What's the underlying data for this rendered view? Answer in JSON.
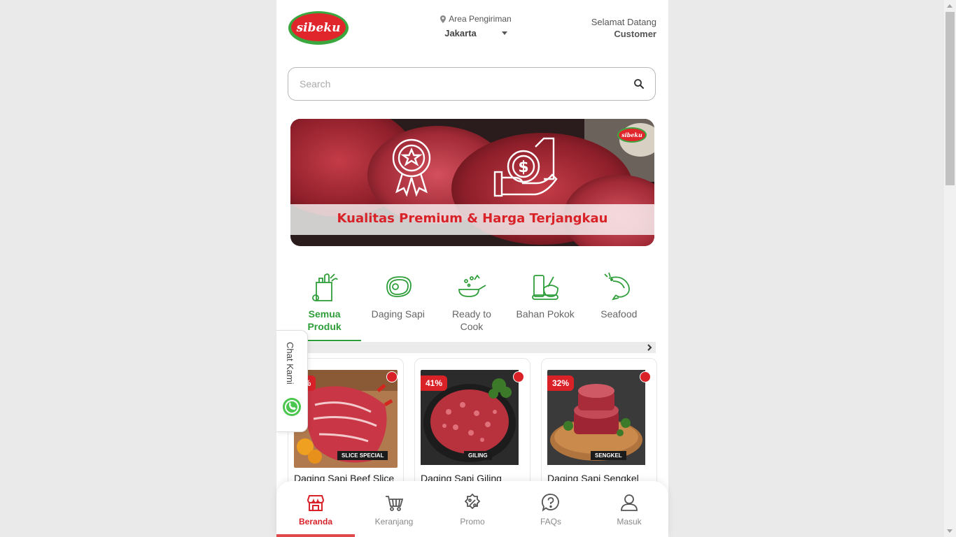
{
  "header": {
    "logo_text": "sibeku",
    "area_label": "Area Pengiriman",
    "area_value": "Jakarta",
    "welcome_label": "Selamat Datang",
    "welcome_user": "Customer"
  },
  "search": {
    "placeholder": "Search",
    "value": ""
  },
  "banner": {
    "text": "Kualitas Premium & Harga Terjangkau",
    "logo_text": "sibeku"
  },
  "categories": [
    {
      "label": "Semua Produk",
      "icon": "grocery-bag-icon",
      "active": true
    },
    {
      "label": "Daging Sapi",
      "icon": "steak-icon",
      "active": false
    },
    {
      "label": "Ready to Cook",
      "icon": "frying-pan-icon",
      "active": false
    },
    {
      "label": "Bahan Pokok",
      "icon": "ingredients-icon",
      "active": false
    },
    {
      "label": "Seafood",
      "icon": "shrimp-icon",
      "active": false
    }
  ],
  "products": [
    {
      "name": "Daging Sapi Beef Slice",
      "discount": "0%",
      "pack_label": "SLICE SPECIAL"
    },
    {
      "name": "Daging Sapi Giling",
      "discount": "41%",
      "pack_label": "GILING"
    },
    {
      "name": "Daging Sapi Sengkel",
      "discount": "32%",
      "pack_label": "SENGKEL"
    }
  ],
  "chat": {
    "label": "Chat Kami",
    "icon": "whatsapp-icon"
  },
  "bottom_nav": [
    {
      "label": "Beranda",
      "icon": "store-icon",
      "active": true
    },
    {
      "label": "Keranjang",
      "icon": "cart-icon",
      "active": false
    },
    {
      "label": "Promo",
      "icon": "discount-icon",
      "active": false
    },
    {
      "label": "FAQs",
      "icon": "question-icon",
      "active": false
    },
    {
      "label": "Masuk",
      "icon": "user-icon",
      "active": false
    }
  ],
  "colors": {
    "brand_red": "#d92128",
    "brand_green": "#2f9e3a",
    "page_bg": "#eaeaea"
  }
}
